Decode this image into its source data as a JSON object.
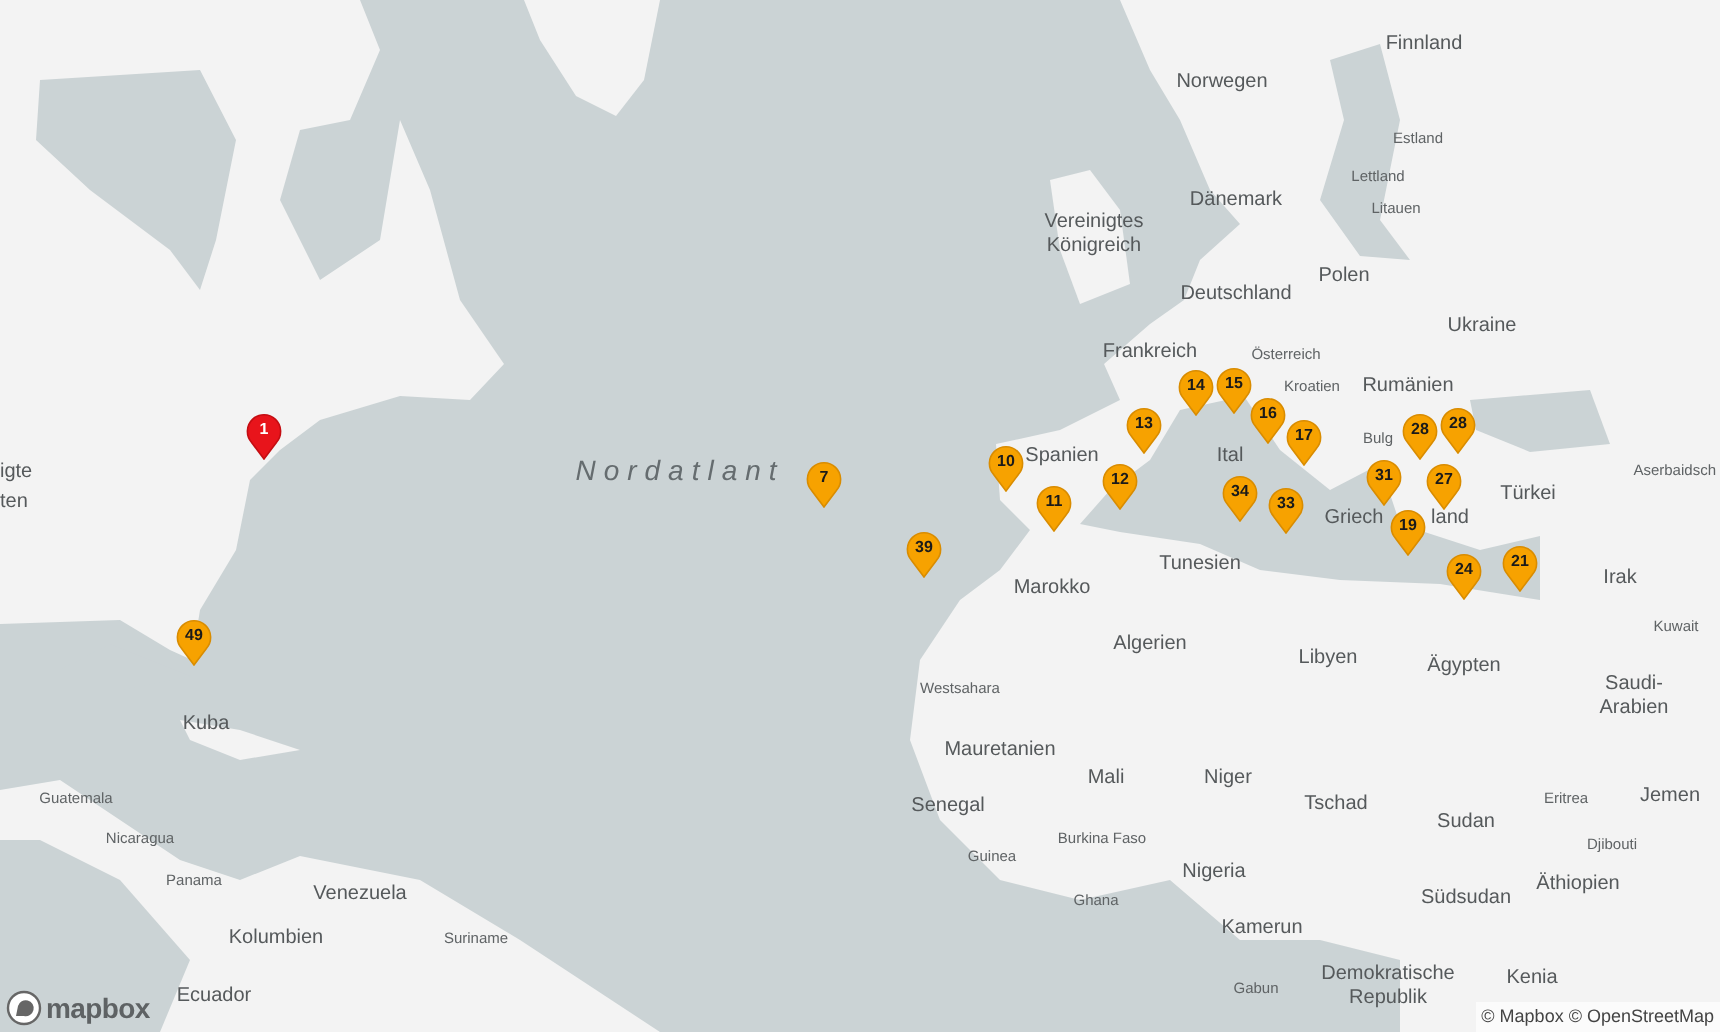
{
  "labels": [
    {
      "text": "Finnland",
      "kind": "country"
    },
    {
      "text": "Norwegen",
      "kind": "country"
    },
    {
      "text": "Estland",
      "kind": "small"
    },
    {
      "text": "Lettland",
      "kind": "small"
    },
    {
      "text": "Dänemark",
      "kind": "country"
    },
    {
      "text": "Litauen",
      "kind": "small"
    },
    {
      "text": "Vereinigtes Königreich",
      "kind": "country"
    },
    {
      "text": "Polen",
      "kind": "country"
    },
    {
      "text": "Deutschland",
      "kind": "country"
    },
    {
      "text": "Ukraine",
      "kind": "country"
    },
    {
      "text": "Frankreich",
      "kind": "country"
    },
    {
      "text": "Österreich",
      "kind": "small"
    },
    {
      "text": "Kroatien",
      "kind": "small"
    },
    {
      "text": "Rumänien",
      "kind": "country"
    },
    {
      "text": "igte",
      "kind": "country"
    },
    {
      "text": "Nordatlant",
      "kind": "ocean"
    },
    {
      "text": "Spanien",
      "kind": "country"
    },
    {
      "text": "Ital",
      "kind": "country"
    },
    {
      "text": "Bulg",
      "kind": "small"
    },
    {
      "text": "Aserbaidsch",
      "kind": "small"
    },
    {
      "text": "ten",
      "kind": "country"
    },
    {
      "text": "Türkei",
      "kind": "country"
    },
    {
      "text": "Griech",
      "kind": "country"
    },
    {
      "text": "land",
      "kind": "country"
    },
    {
      "text": "Marokko",
      "kind": "country"
    },
    {
      "text": "Tunesien",
      "kind": "country"
    },
    {
      "text": "Irak",
      "kind": "country"
    },
    {
      "text": "Kuwait",
      "kind": "small"
    },
    {
      "text": "Algerien",
      "kind": "country"
    },
    {
      "text": "Libyen",
      "kind": "country"
    },
    {
      "text": "Ägypten",
      "kind": "country"
    },
    {
      "text": "Westsahara",
      "kind": "small"
    },
    {
      "text": "Kuba",
      "kind": "country"
    },
    {
      "text": "Saudi-Arabien",
      "kind": "country"
    },
    {
      "text": "Mauretanien",
      "kind": "country"
    },
    {
      "text": "Guatemala",
      "kind": "small"
    },
    {
      "text": "Senegal",
      "kind": "country"
    },
    {
      "text": "Mali",
      "kind": "country"
    },
    {
      "text": "Niger",
      "kind": "country"
    },
    {
      "text": "Tschad",
      "kind": "country"
    },
    {
      "text": "Eritrea",
      "kind": "small"
    },
    {
      "text": "Jemen",
      "kind": "country"
    },
    {
      "text": "Sudan",
      "kind": "country"
    },
    {
      "text": "Nicaragua",
      "kind": "small"
    },
    {
      "text": "Guinea",
      "kind": "small"
    },
    {
      "text": "Burkina Faso",
      "kind": "small"
    },
    {
      "text": "Djibouti",
      "kind": "small"
    },
    {
      "text": "Panama",
      "kind": "small"
    },
    {
      "text": "Venezuela",
      "kind": "country"
    },
    {
      "text": "Nigeria",
      "kind": "country"
    },
    {
      "text": "Ghana",
      "kind": "small"
    },
    {
      "text": "Südsudan",
      "kind": "country"
    },
    {
      "text": "Äthiopien",
      "kind": "country"
    },
    {
      "text": "Kolumbien",
      "kind": "country"
    },
    {
      "text": "Suriname",
      "kind": "small"
    },
    {
      "text": "Kamerun",
      "kind": "country"
    },
    {
      "text": "Ecuador",
      "kind": "country"
    },
    {
      "text": "Gabun",
      "kind": "small"
    },
    {
      "text": "Demokratische Republik",
      "kind": "country"
    },
    {
      "text": "Kenia",
      "kind": "country"
    }
  ],
  "pins": [
    {
      "label": "1",
      "selected": true
    },
    {
      "label": "7",
      "selected": false
    },
    {
      "label": "49",
      "selected": false
    },
    {
      "label": "39",
      "selected": false
    },
    {
      "label": "10",
      "selected": false
    },
    {
      "label": "12",
      "selected": false
    },
    {
      "label": "11",
      "selected": false
    },
    {
      "label": "13",
      "selected": false
    },
    {
      "label": "14",
      "selected": false
    },
    {
      "label": "15",
      "selected": false
    },
    {
      "label": "16",
      "selected": false
    },
    {
      "label": "17",
      "selected": false
    },
    {
      "label": "34",
      "selected": false
    },
    {
      "label": "33",
      "selected": false
    },
    {
      "label": "28",
      "selected": false
    },
    {
      "label": "28",
      "selected": false
    },
    {
      "label": "31",
      "selected": false
    },
    {
      "label": "27",
      "selected": false
    },
    {
      "label": "19",
      "selected": false
    },
    {
      "label": "24",
      "selected": false
    },
    {
      "label": "21",
      "selected": false
    }
  ],
  "logo": {
    "text": "mapbox"
  },
  "attribution": "© Mapbox © OpenStreetMap"
}
